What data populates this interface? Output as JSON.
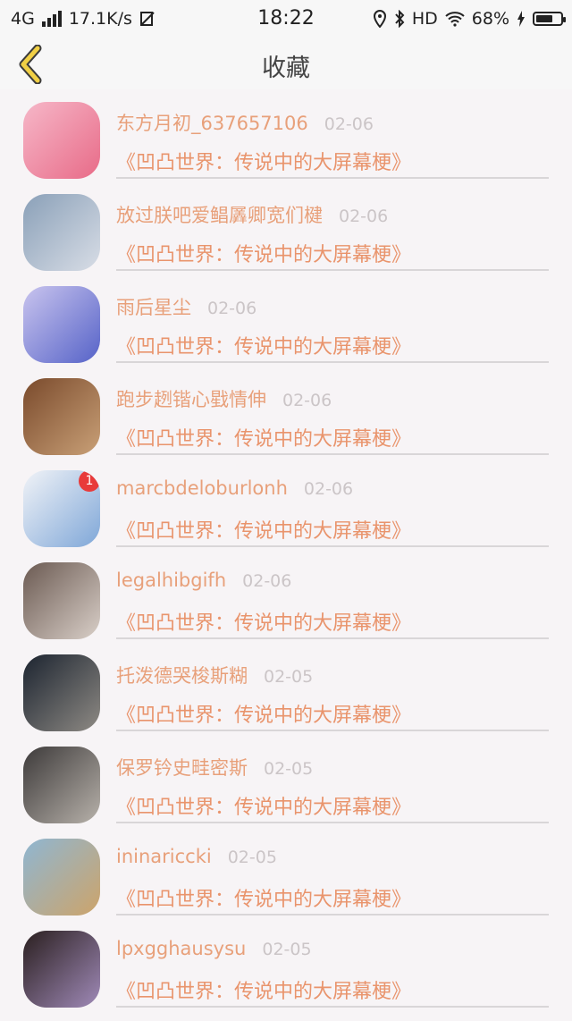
{
  "status_bar": {
    "network": "4G",
    "speed": "17.1K/s",
    "time": "18:22",
    "hd": "HD",
    "battery_percent": "68%",
    "battery_level": 0.68
  },
  "nav": {
    "title": "收藏"
  },
  "favorites": [
    {
      "name": "东方月初_637657106",
      "date": "02-06",
      "title": "《凹凸世界：传说中的大屏幕梗》",
      "avatar_colors": [
        "#f6b7c8",
        "#e86b88"
      ]
    },
    {
      "name": "放过朕吧爱鲳羼卿宽们楗",
      "date": "02-06",
      "title": "《凹凸世界：传说中的大屏幕梗》",
      "avatar_colors": [
        "#8aa0b8",
        "#d8dde6"
      ]
    },
    {
      "name": "雨后星尘",
      "date": "02-06",
      "title": "《凹凸世界：传说中的大屏幕梗》",
      "avatar_colors": [
        "#c9c4ee",
        "#5663c8"
      ]
    },
    {
      "name": "跑步趔锴心戥情伸",
      "date": "02-06",
      "title": "《凹凸世界：传说中的大屏幕梗》",
      "avatar_colors": [
        "#7a4a2c",
        "#c9a077"
      ]
    },
    {
      "name": "marcbdeloburlonh",
      "date": "02-06",
      "title": "《凹凸世界：传说中的大屏幕梗》",
      "avatar_colors": [
        "#f1f3f7",
        "#7fa7d8"
      ],
      "badge": "1"
    },
    {
      "name": "legalhibgifh",
      "date": "02-06",
      "title": "《凹凸世界：传说中的大屏幕梗》",
      "avatar_colors": [
        "#6b5a52",
        "#d9cfc8"
      ]
    },
    {
      "name": "托泼德哭梭斯糊",
      "date": "02-05",
      "title": "《凹凸世界：传说中的大屏幕梗》",
      "avatar_colors": [
        "#1c2430",
        "#8e8a84"
      ]
    },
    {
      "name": "保罗钤史畦密斯",
      "date": "02-05",
      "title": "《凹凸世界：传说中的大屏幕梗》",
      "avatar_colors": [
        "#3d3a3a",
        "#b7b1aa"
      ]
    },
    {
      "name": "ininariccki",
      "date": "02-05",
      "title": "《凹凸世界：传说中的大屏幕梗》",
      "avatar_colors": [
        "#8fb6d2",
        "#cda46a"
      ]
    },
    {
      "name": "lpxgghausysu",
      "date": "02-05",
      "title": "《凹凸世界：传说中的大屏幕梗》",
      "avatar_colors": [
        "#2a1f1f",
        "#a08ab8"
      ]
    }
  ]
}
